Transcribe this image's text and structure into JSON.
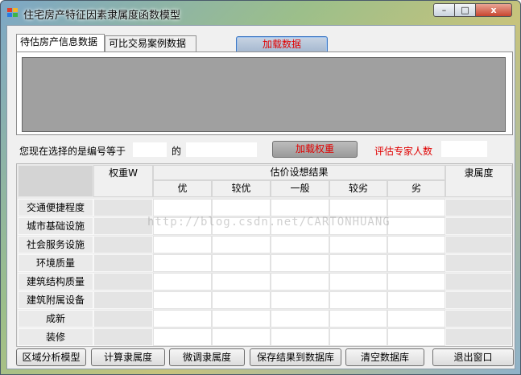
{
  "window": {
    "title": "住宅房产特征因素隶属度函数模型",
    "controls": {
      "minimize": "–",
      "maximize": "□",
      "close": "x"
    }
  },
  "tabs": [
    {
      "label": "待估房产信息数据",
      "active": true
    },
    {
      "label": "可比交易案例数据",
      "active": false
    }
  ],
  "toolbar": {
    "load_data_label": "加载数据",
    "selection_prefix": "您现在选择的是编号等于",
    "selection_of": "的",
    "load_weight_label": "加载权重",
    "expert_count_label": "评估专家人数"
  },
  "table": {
    "weight_header": "权重W",
    "result_header": "估价设想结果",
    "membership_header": "隶属度",
    "grades": [
      "优",
      "较优",
      "一般",
      "较劣",
      "劣"
    ],
    "rows": [
      "交通便捷程度",
      "城市基础设施",
      "社会服务设施",
      "环境质量",
      "建筑结构质量",
      "建筑附属设备",
      "成新",
      "装修"
    ]
  },
  "watermark": "http://blog.csdn.net/CARTONHUANG",
  "buttons": {
    "region_model": "区域分析模型",
    "calc_membership": "计算隶属度",
    "adjust_membership": "微调隶属度",
    "save_db": "保存结果到数据库",
    "clear_db": "清空数据库",
    "exit": "退出窗口"
  },
  "colors": {
    "accent_red": "#e00000",
    "grid_gray": "#a0a0a0"
  }
}
